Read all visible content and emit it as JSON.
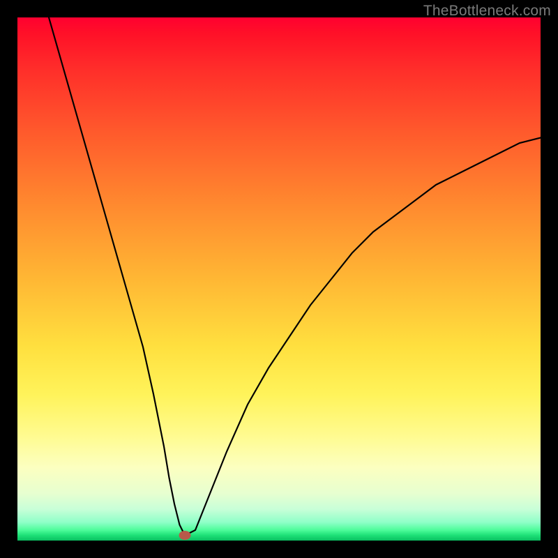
{
  "watermark": "TheBottleneck.com",
  "chart_data": {
    "type": "line",
    "title": "",
    "xlabel": "",
    "ylabel": "",
    "xlim": [
      0,
      100
    ],
    "ylim": [
      0,
      100
    ],
    "grid": false,
    "marker": {
      "x": 32,
      "y": 1
    },
    "series": [
      {
        "name": "curve",
        "x": [
          6,
          8,
          10,
          12,
          14,
          16,
          18,
          20,
          22,
          24,
          26,
          28,
          29,
          30,
          31,
          32,
          34,
          36,
          38,
          40,
          44,
          48,
          52,
          56,
          60,
          64,
          68,
          72,
          76,
          80,
          84,
          88,
          92,
          96,
          100
        ],
        "values": [
          100,
          93,
          86,
          79,
          72,
          65,
          58,
          51,
          44,
          37,
          28,
          18,
          12,
          7,
          3,
          1,
          2,
          7,
          12,
          17,
          26,
          33,
          39,
          45,
          50,
          55,
          59,
          62,
          65,
          68,
          70,
          72,
          74,
          76,
          77
        ]
      }
    ],
    "gradient_stops": [
      {
        "pct": 0,
        "color": "#ff0030"
      },
      {
        "pct": 50,
        "color": "#ffe03f"
      },
      {
        "pct": 100,
        "color": "#0ac060"
      }
    ]
  }
}
